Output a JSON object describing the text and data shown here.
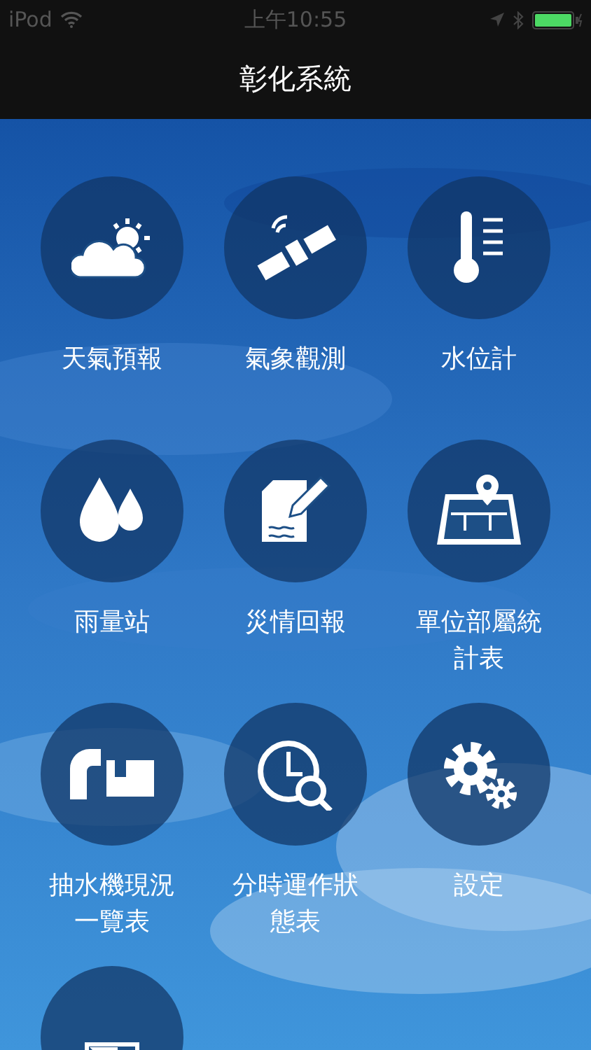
{
  "status_bar": {
    "carrier": "iPod",
    "time": "上午10:55"
  },
  "nav_bar": {
    "title": "彰化系統"
  },
  "menu": [
    {
      "kind": "weather",
      "label": "天氣預報"
    },
    {
      "kind": "satellite",
      "label": "氣象觀測"
    },
    {
      "kind": "thermometer",
      "label": "水位計"
    },
    {
      "kind": "drops",
      "label": "雨量站"
    },
    {
      "kind": "report",
      "label": "災情回報"
    },
    {
      "kind": "map",
      "label": "單位部屬統計表"
    },
    {
      "kind": "pump",
      "label": "抽水機現況一覽表"
    },
    {
      "kind": "clock",
      "label": "分時運作狀態表"
    },
    {
      "kind": "gears",
      "label": "設定"
    },
    {
      "kind": "document"
    }
  ]
}
